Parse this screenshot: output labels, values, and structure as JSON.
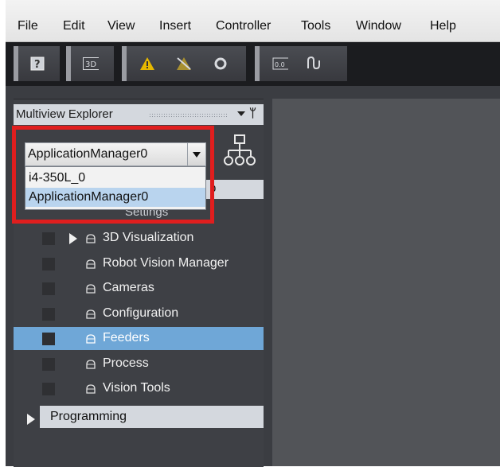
{
  "menu": [
    "File",
    "Edit",
    "View",
    "Insert",
    "Controller",
    "Tools",
    "Window",
    "Help"
  ],
  "toolbar": {
    "icons": [
      "help-icon",
      "3d-icon",
      "warning-icon",
      "warning-off-icon",
      "refresh-icon",
      "monitor-icon",
      "connect-icon"
    ],
    "help_label": "?",
    "threed_label": "3D",
    "monitor_label": "0.0"
  },
  "explorer": {
    "title": "Multiview Explorer",
    "pin_glyph": "ᛘ",
    "selector": {
      "value": "ApplicationManager0",
      "options": [
        "i4-350L_0",
        "ApplicationManager0"
      ],
      "selected_index": 1
    },
    "peek_char": "p",
    "settings_peek": "Settings",
    "items": [
      {
        "label": "3D Visualization",
        "expandable": true
      },
      {
        "label": "Robot Vision Manager",
        "expandable": false
      },
      {
        "label": "Cameras",
        "expandable": false
      },
      {
        "label": "Configuration",
        "expandable": false
      },
      {
        "label": "Feeders",
        "expandable": false,
        "selected": true
      },
      {
        "label": "Process",
        "expandable": false
      },
      {
        "label": "Vision Tools",
        "expandable": false
      }
    ],
    "programming_label": "Programming"
  },
  "colors": {
    "highlight_box": "#e01e1e",
    "selected_row": "#6fa7d7",
    "panel_bg": "#3e4045"
  }
}
